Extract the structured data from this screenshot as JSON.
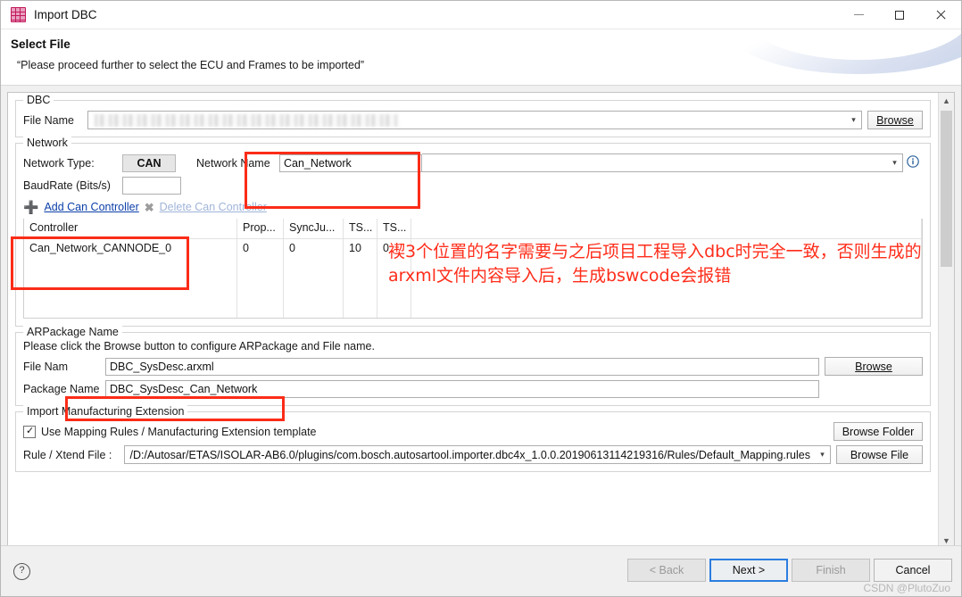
{
  "window": {
    "title": "Import DBC",
    "icon": "dbc-grid-icon",
    "controls": {
      "minimize": "minimize-button",
      "maximize": "maximize-button",
      "close": "close-button"
    }
  },
  "header": {
    "title": "Select File",
    "subtitle": "“Please proceed further to select the ECU and Frames to be imported”"
  },
  "dbc_group": {
    "legend": "DBC",
    "file_name_label": "File Name",
    "file_name_value": "",
    "browse_label": "Browse"
  },
  "network_group": {
    "legend": "Network",
    "network_type_label": "Network Type:",
    "network_type_value": "CAN",
    "network_name_label": "Network Name",
    "network_name_value": "Can_Network",
    "baudrate_label": "BaudRate (Bits/s)",
    "baudrate_value": "",
    "info_icon": "info-icon",
    "add_controller_label": "Add Can Controller",
    "delete_controller_label": "Delete Can Controller",
    "table": {
      "headers": [
        "Controller",
        "Prop...",
        "SyncJu...",
        "TS...",
        "TS...",
        ""
      ],
      "rows": [
        [
          "Can_Network_CANNODE_0",
          "0",
          "0",
          "10",
          "0",
          ""
        ],
        [
          "",
          "",
          "",
          "",
          "",
          ""
        ],
        [
          "",
          "",
          "",
          "",
          "",
          ""
        ],
        [
          "",
          "",
          "",
          "",
          "",
          ""
        ]
      ]
    }
  },
  "arpackage_group": {
    "legend": "ARPackage Name",
    "hint": "Please click the Browse button to configure ARPackage and File name.",
    "file_name_label": "File Nam",
    "file_name_value": "DBC_SysDesc.arxml",
    "package_name_label": "Package Name",
    "package_name_value": "DBC_SysDesc_Can_Network",
    "browse_label": "Browse"
  },
  "manufacturing_group": {
    "legend": "Import Manufacturing Extension",
    "checkbox_label": "Use Mapping Rules / Manufacturing Extension template",
    "checkbox_checked": true,
    "browse_folder_label": "Browse Folder",
    "rule_file_label": "Rule / Xtend File :",
    "rule_file_value": "/D:/Autosar/ETAS/ISOLAR-AB6.0/plugins/com.bosch.autosartool.importer.dbc4x_1.0.0.20190613114219316/Rules/Default_Mapping.rules",
    "browse_file_label": "Browse File"
  },
  "annotation": {
    "text": "褉3个位置的名字需要与之后项目工程导入dbc时完全一致，否则生成的arxml文件内容导入后，生成bswcode会报错",
    "color": "#ff2d1a"
  },
  "footer": {
    "help_icon": "help-icon",
    "back_label": "< Back",
    "next_label": "Next >",
    "finish_label": "Finish",
    "cancel_label": "Cancel"
  },
  "watermark": "CSDN @PlutoZuo"
}
